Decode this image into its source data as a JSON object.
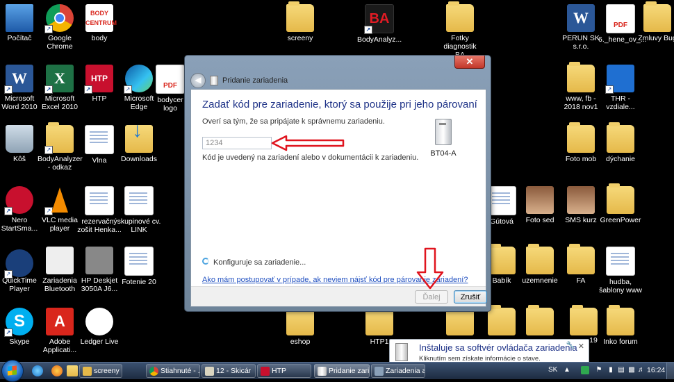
{
  "desktop": {
    "icons": {
      "pocitac": "Počítač",
      "chrome": "Google Chrome",
      "body": "body",
      "screeny": "screeny",
      "bodyanalyz": "BodyAnalyz...",
      "fotky": "Fotky diagnostik BA",
      "perun": "PERUN SK s.r.o.",
      "hene": "6._hene_ov_...",
      "zmluvy": "Zmluvy Bug",
      "word2010": "Microsoft Word 2010",
      "excel2010": "Microsoft Excel 2010",
      "htp": "HTP",
      "edge": "Microsoft Edge",
      "bodycer": "bodycer logo",
      "www": "www, fb - 2018 nov1",
      "thr": "THR - vzdiale...",
      "kos": "Kôš",
      "bodyanalyzer_odkaz": "BodyAnalyzer - odkaz",
      "vlna": "Vlna",
      "downloads": "Downloads",
      "fotomob": "Foto mob",
      "dychanie": "dýchanie",
      "nero": "Nero StartSma...",
      "vlc": "VLC media player",
      "rezervacny": "rezervačný zošit Henka...",
      "skupinove": "skupinové cv. LINK",
      "gutova": "Gútová",
      "fotosed": "Foto sed",
      "smskurz": "SMS kurz",
      "greenpower": "GreenPower",
      "quicktime": "QuickTime Player",
      "zariadenia": "Zariadenia Bluetooth",
      "hpdeskjet": "HP Deskjet 3050A J6...",
      "fotenie": "Fotenie 20",
      "babik": "Babík",
      "uzemnenie": "uzemnenie",
      "fa": "FA",
      "hudba": "hudba, šablony www",
      "skype": "Skype",
      "adobe": "Adobe Applicati...",
      "ledger": "Ledger Live",
      "eshop": "eshop",
      "htp1": "HTP1",
      "inko": "Inko forum",
      "nineteen": "19"
    }
  },
  "dialog": {
    "title": "Pridanie zariadenia",
    "close_label": "✕",
    "heading": "Zadať kód pre zariadenie, ktorý sa použije pri jeho párovaní",
    "subtitle": "Overí sa tým, že sa pripájate k správnemu zariadeniu.",
    "code_value": "1234",
    "hint": "Kód je uvedený na zariadení alebo v dokumentácii k zariadeniu.",
    "device_name": "BT04-A",
    "status": "Konfiguruje sa zariadenie...",
    "help_link": "Ako mám postupovať v prípade, ak neviem nájsť kód pre párovanie zariadení?",
    "next_label": "Ďalej",
    "cancel_label": "Zrušiť"
  },
  "notification": {
    "title": "Inštaluje sa softvér ovládača zariadenia",
    "subtitle": "Kliknutím sem získate informácie o stave."
  },
  "taskbar": {
    "tasks": [
      "screeny",
      "Stiahnuté - ...",
      "12 - Skicár",
      "HTP",
      "Pridanie zari...",
      "Zariadenia a ..."
    ],
    "language": "SK",
    "clock": "16:24"
  },
  "colors": {
    "heading": "#1e3287",
    "link": "#1f4fc0",
    "annotation": "#e0141e"
  }
}
